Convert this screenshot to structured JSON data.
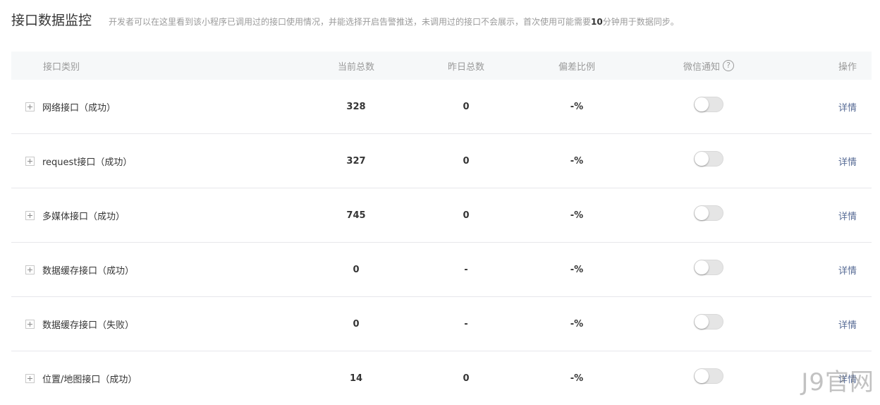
{
  "header": {
    "title": "接口数据监控",
    "desc_before": "开发者可以在这里看到该小程序已调用过的接口使用情况，并能选择开启告警推送，未调用过的接口不会展示，首次使用可能需要",
    "desc_strong": "10",
    "desc_after": "分钟用于数据同步。"
  },
  "table": {
    "columns": {
      "category": "接口类别",
      "current": "当前总数",
      "yesterday": "昨日总数",
      "deviation": "偏差比例",
      "wechat": "微信通知",
      "help_glyph": "?",
      "action": "操作"
    },
    "rows": [
      {
        "category": "网络接口（成功）",
        "current": "328",
        "yesterday": "0",
        "deviation": "-%",
        "notify_on": false,
        "action": "详情"
      },
      {
        "category": "request接口（成功）",
        "current": "327",
        "yesterday": "0",
        "deviation": "-%",
        "notify_on": false,
        "action": "详情"
      },
      {
        "category": "多媒体接口（成功）",
        "current": "745",
        "yesterday": "0",
        "deviation": "-%",
        "notify_on": false,
        "action": "详情"
      },
      {
        "category": "数据缓存接口（成功）",
        "current": "0",
        "yesterday": "-",
        "deviation": "-%",
        "notify_on": false,
        "action": "详情"
      },
      {
        "category": "数据缓存接口（失败）",
        "current": "0",
        "yesterday": "-",
        "deviation": "-%",
        "notify_on": false,
        "action": "详情"
      },
      {
        "category": "位置/地图接口（成功）",
        "current": "14",
        "yesterday": "0",
        "deviation": "-%",
        "notify_on": false,
        "action": "详情"
      }
    ]
  },
  "watermark": "J9官网",
  "colors": {
    "link": "#576b95",
    "header_bg": "#f6f8f9",
    "switch_off": "#e5e5e5"
  }
}
